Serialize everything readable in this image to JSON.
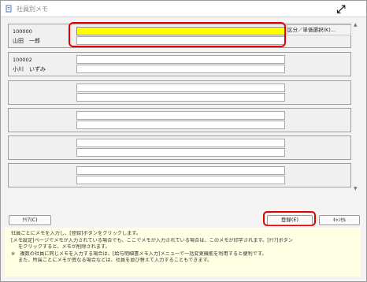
{
  "window": {
    "title": "社員別メモ",
    "expand_icon": "⤢"
  },
  "rows": [
    {
      "code": "100000",
      "name": "山田　一郎",
      "memo1": "",
      "memo2": ""
    },
    {
      "code": "100002",
      "name": "小川　いずみ",
      "memo1": "",
      "memo2": ""
    },
    {
      "code": "",
      "name": "",
      "memo1": "",
      "memo2": ""
    },
    {
      "code": "",
      "name": "",
      "memo1": "",
      "memo2": ""
    },
    {
      "code": "",
      "name": "",
      "memo1": "",
      "memo2": ""
    },
    {
      "code": "",
      "name": "",
      "memo1": "",
      "memo2": ""
    }
  ],
  "kubun_button": "区分／単価選択(K)...",
  "scroll": {
    "up": "▲",
    "down": "▼"
  },
  "buttons": {
    "clear": "ｸﾘｱ(C)",
    "register": "登録(E)",
    "cancel": "ｷｬﾝｾﾙ"
  },
  "help": {
    "line1": "社員ごとにメモを入力し、[登録]ボタンをクリックします。",
    "line2": "[メモ設定]ページでメモが入力されている場合でも、ここでメモが入力されている場合は、このメモが印字されます。[ｸﾘｱ]ボタン",
    "line3": "をクリックすると、メモが削除されます。",
    "line4": "※　複数の社員に同じメモを入力する場合は、[給与明細書メモ入力]メニューで一括変更機能を利用すると便利です。",
    "line5": "また、所属ごとにメモが異なる場合などは、社員を並び替えて入力することもできます。"
  },
  "colors": {
    "highlight": "#e30000",
    "active_field": "#ffff00",
    "help_bg": "#ffffe3"
  }
}
